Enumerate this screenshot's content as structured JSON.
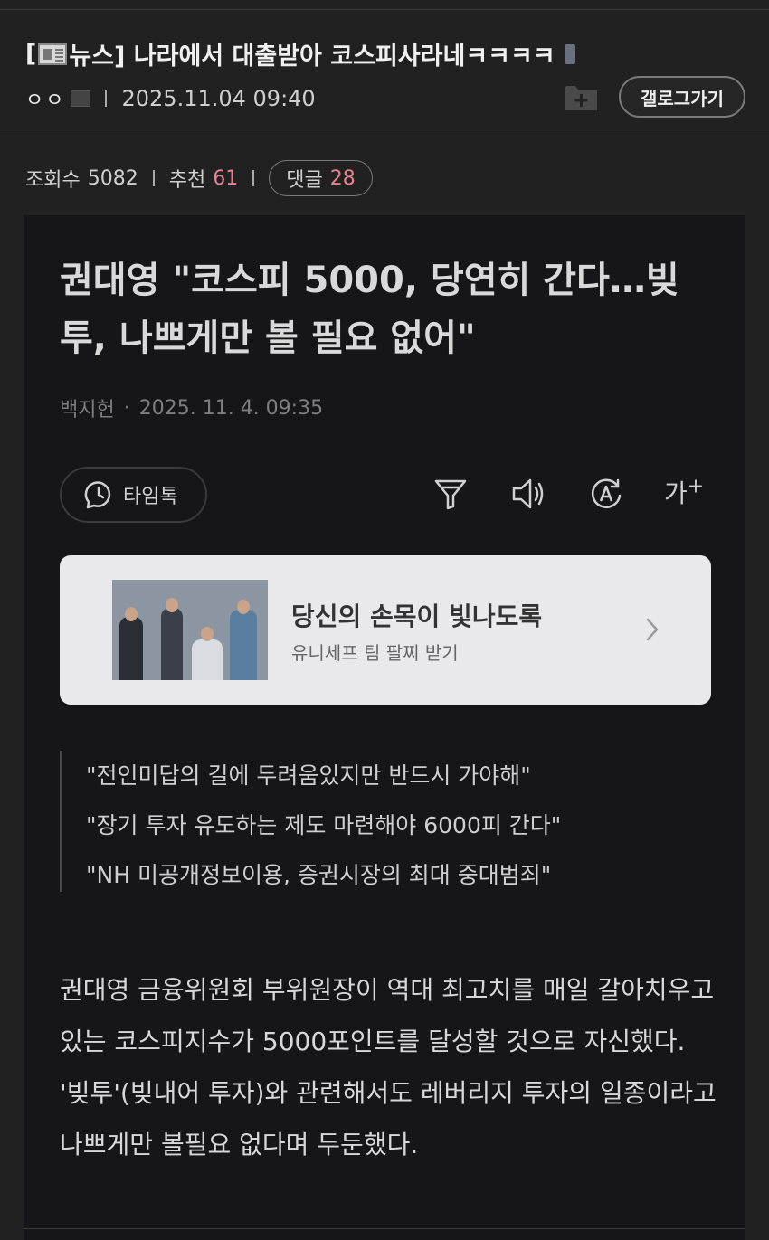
{
  "post": {
    "title_prefix": "[",
    "title_main": "뉴스] 나라에서 대출받아 코스피사라네ㅋㅋㅋㅋ",
    "author": "ㅇㅇ",
    "datetime": "2025.11.04 09:40",
    "gallery_button": "갤로그가기"
  },
  "stats": {
    "views_label": "조회수",
    "views": "5082",
    "recommend_label": "추천",
    "recommend": "61",
    "comments_label": "댓글",
    "comments": "28"
  },
  "article": {
    "headline": "권대영 \"코스피 5000, 당연히 간다…빚투, 나쁘게만 볼 필요 없어\"",
    "reporter": "백지헌",
    "date": "2025. 11. 4. 09:35",
    "timetalk_label": "타임톡",
    "font_size_label": "가",
    "promo": {
      "title": "당신의 손목이 빛나도록",
      "subtitle": "유니세프 팀 팔찌 받기"
    },
    "quotes": [
      "\"전인미답의 길에 두려움있지만 반드시 가야해\"",
      "\"장기 투자 유도하는 제도 마련해야 6000피 간다\"",
      "\"NH 미공개정보이용, 증권시장의 최대 중대범죄\""
    ],
    "body": "권대영 금융위원회 부위원장이 역대 최고치를 매일 갈아치우고 있는 코스피지수가 5000포인트를 달성할 것으로 자신했다. '빚투'(빚내어 투자)와 관련해서도 레버리지 투자의 일종이라고 나쁘게만 볼필요 없다며 두둔했다."
  },
  "colors": {
    "background": "#212121",
    "article_bg": "#161618",
    "accent": "#e8818e",
    "promo_bg": "#e9e9eb"
  },
  "icons": [
    "folder-plus-icon",
    "clock-icon",
    "filter-icon",
    "speaker-icon",
    "auto-translate-icon",
    "chevron-right-icon"
  ]
}
